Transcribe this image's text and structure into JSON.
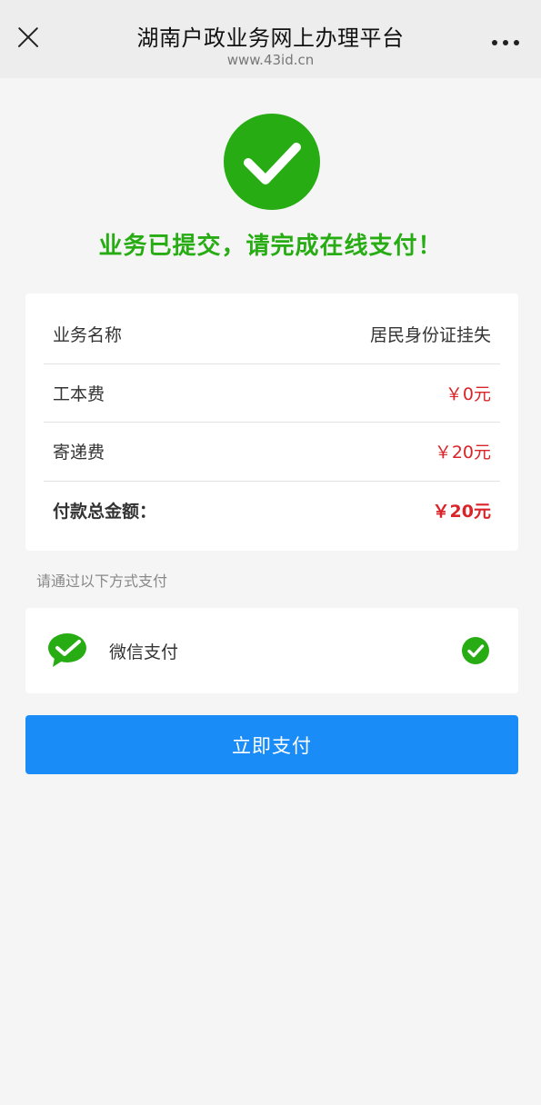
{
  "header": {
    "title": "湖南户政业务网上办理平台",
    "url": "www.43id.cn"
  },
  "status": {
    "message": "业务已提交，请完成在线支付！",
    "color": "#27ac14"
  },
  "fees": [
    {
      "label": "业务名称",
      "value": "居民身份证挂失"
    },
    {
      "label": "工本费",
      "value": "￥0元"
    },
    {
      "label": "寄递费",
      "value": "￥20元"
    },
    {
      "label": "付款总金额：",
      "value": "￥20元"
    }
  ],
  "payment": {
    "hint": "请通过以下方式支付",
    "method_label": "微信支付",
    "method_icon": "wechat-icon",
    "button_label": "立即支付",
    "button_color": "#1a8cf8",
    "amount_color": "#d9252a"
  }
}
